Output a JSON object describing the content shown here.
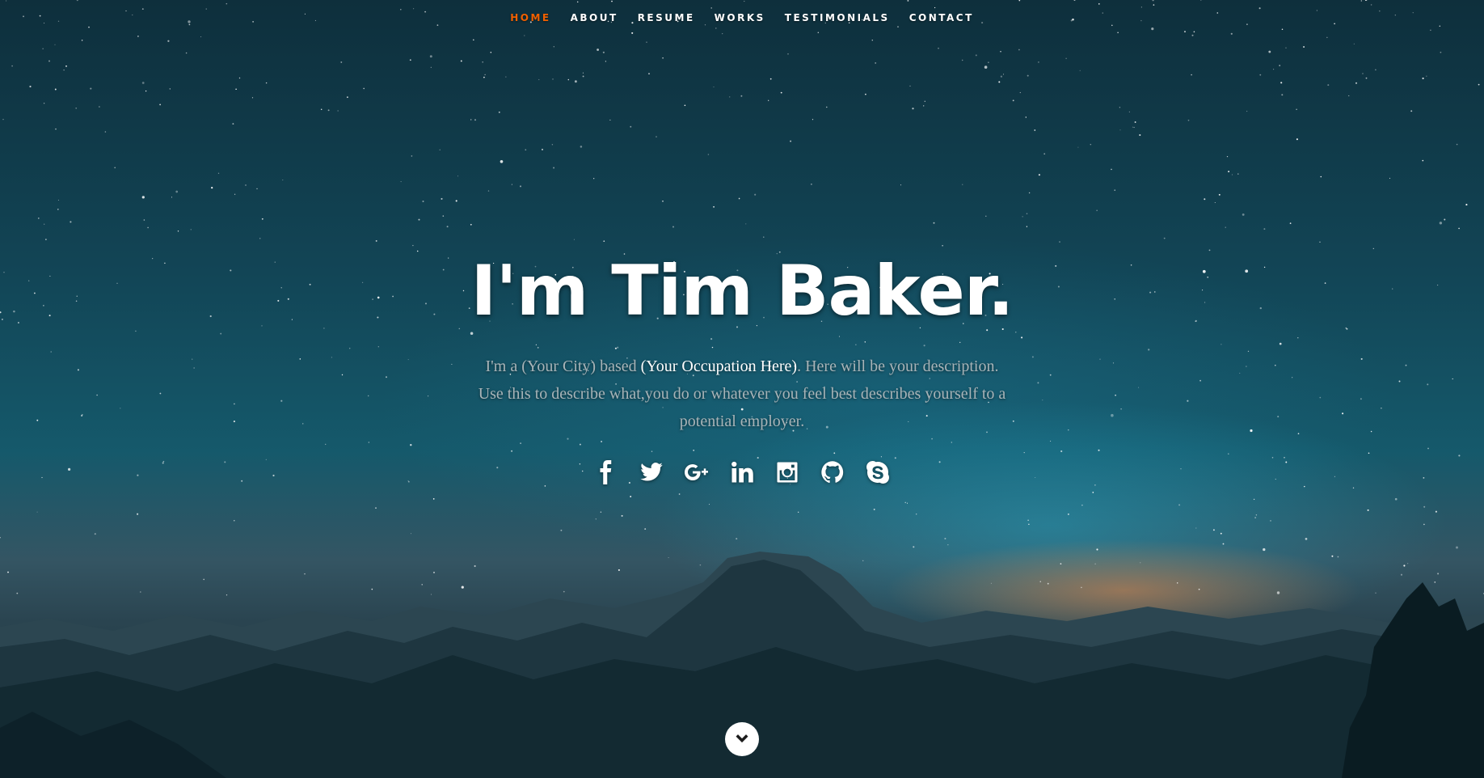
{
  "nav": {
    "items": [
      {
        "label": "HOME",
        "active": true
      },
      {
        "label": "ABOUT",
        "active": false
      },
      {
        "label": "RESUME",
        "active": false
      },
      {
        "label": "WORKS",
        "active": false
      },
      {
        "label": "TESTIMONIALS",
        "active": false
      },
      {
        "label": "CONTACT",
        "active": false
      }
    ],
    "active_color": "#F06000"
  },
  "banner": {
    "headline": "I'm Tim Baker.",
    "intro_part1": "I'm a (Your City) based ",
    "intro_highlight": "(Your Occupation Here)",
    "intro_part2": ". Here will be your description. Use this to describe what,you do or whatever you feel best describes yourself to a potential employer."
  },
  "social": [
    {
      "icon": "facebook-icon"
    },
    {
      "icon": "twitter-icon"
    },
    {
      "icon": "google-plus-icon"
    },
    {
      "icon": "linkedin-icon"
    },
    {
      "icon": "instagram-icon"
    },
    {
      "icon": "github-icon"
    },
    {
      "icon": "skype-icon"
    }
  ],
  "scroll_down": {
    "icon": "chevron-down-icon"
  },
  "colors": {
    "accent": "#F06000",
    "text": "#ffffff",
    "muted": "#a8b4b8"
  }
}
